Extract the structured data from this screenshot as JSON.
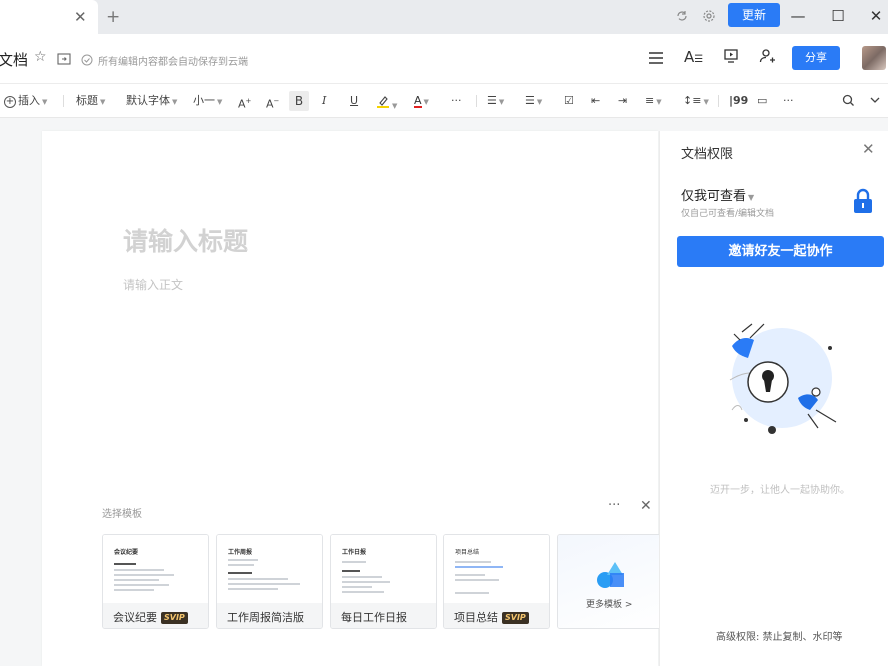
{
  "tab": {
    "close": "✕",
    "add": "+"
  },
  "topbar": {
    "update_label": "更新"
  },
  "window": {
    "minimize": "—",
    "maximize": "☐",
    "close": "✕"
  },
  "titlebar": {
    "title": "文档",
    "autosave": "所有编辑内容都会自动保存到云端",
    "share_label": "分享"
  },
  "toolbar": {
    "insert": "插入",
    "heading": "标题",
    "font": "默认字体",
    "size": "小一",
    "bold": "B",
    "italic": "I",
    "underline": "U",
    "more": "···",
    "more2": "···"
  },
  "editor": {
    "title_placeholder": "请输入标题",
    "body_placeholder": "请输入正文"
  },
  "templates": {
    "label": "选择模板",
    "more": "···",
    "close": "✕",
    "badge": "SVIP",
    "cards": [
      {
        "name": "会议纪要",
        "svip": true,
        "thumb_title": "会议纪要"
      },
      {
        "name": "工作周报简洁版",
        "svip": false,
        "thumb_title": "工作周报"
      },
      {
        "name": "每日工作日报",
        "svip": false,
        "thumb_title": "工作日报"
      },
      {
        "name": "项目总结",
        "svip": true,
        "thumb_title": "项目总结"
      }
    ],
    "more_templates": "更多模板 >"
  },
  "permissions": {
    "title": "文档权限",
    "close": "✕",
    "level": "仅我可查看",
    "level_desc": "仅自己可查看/编辑文档",
    "invite_label": "邀请好友一起协作",
    "slogan": "迈开一步，让他人一起协助你。",
    "advanced": "高级权限: 禁止复制、水印等"
  },
  "colors": {
    "accent": "#2a7bf6"
  }
}
